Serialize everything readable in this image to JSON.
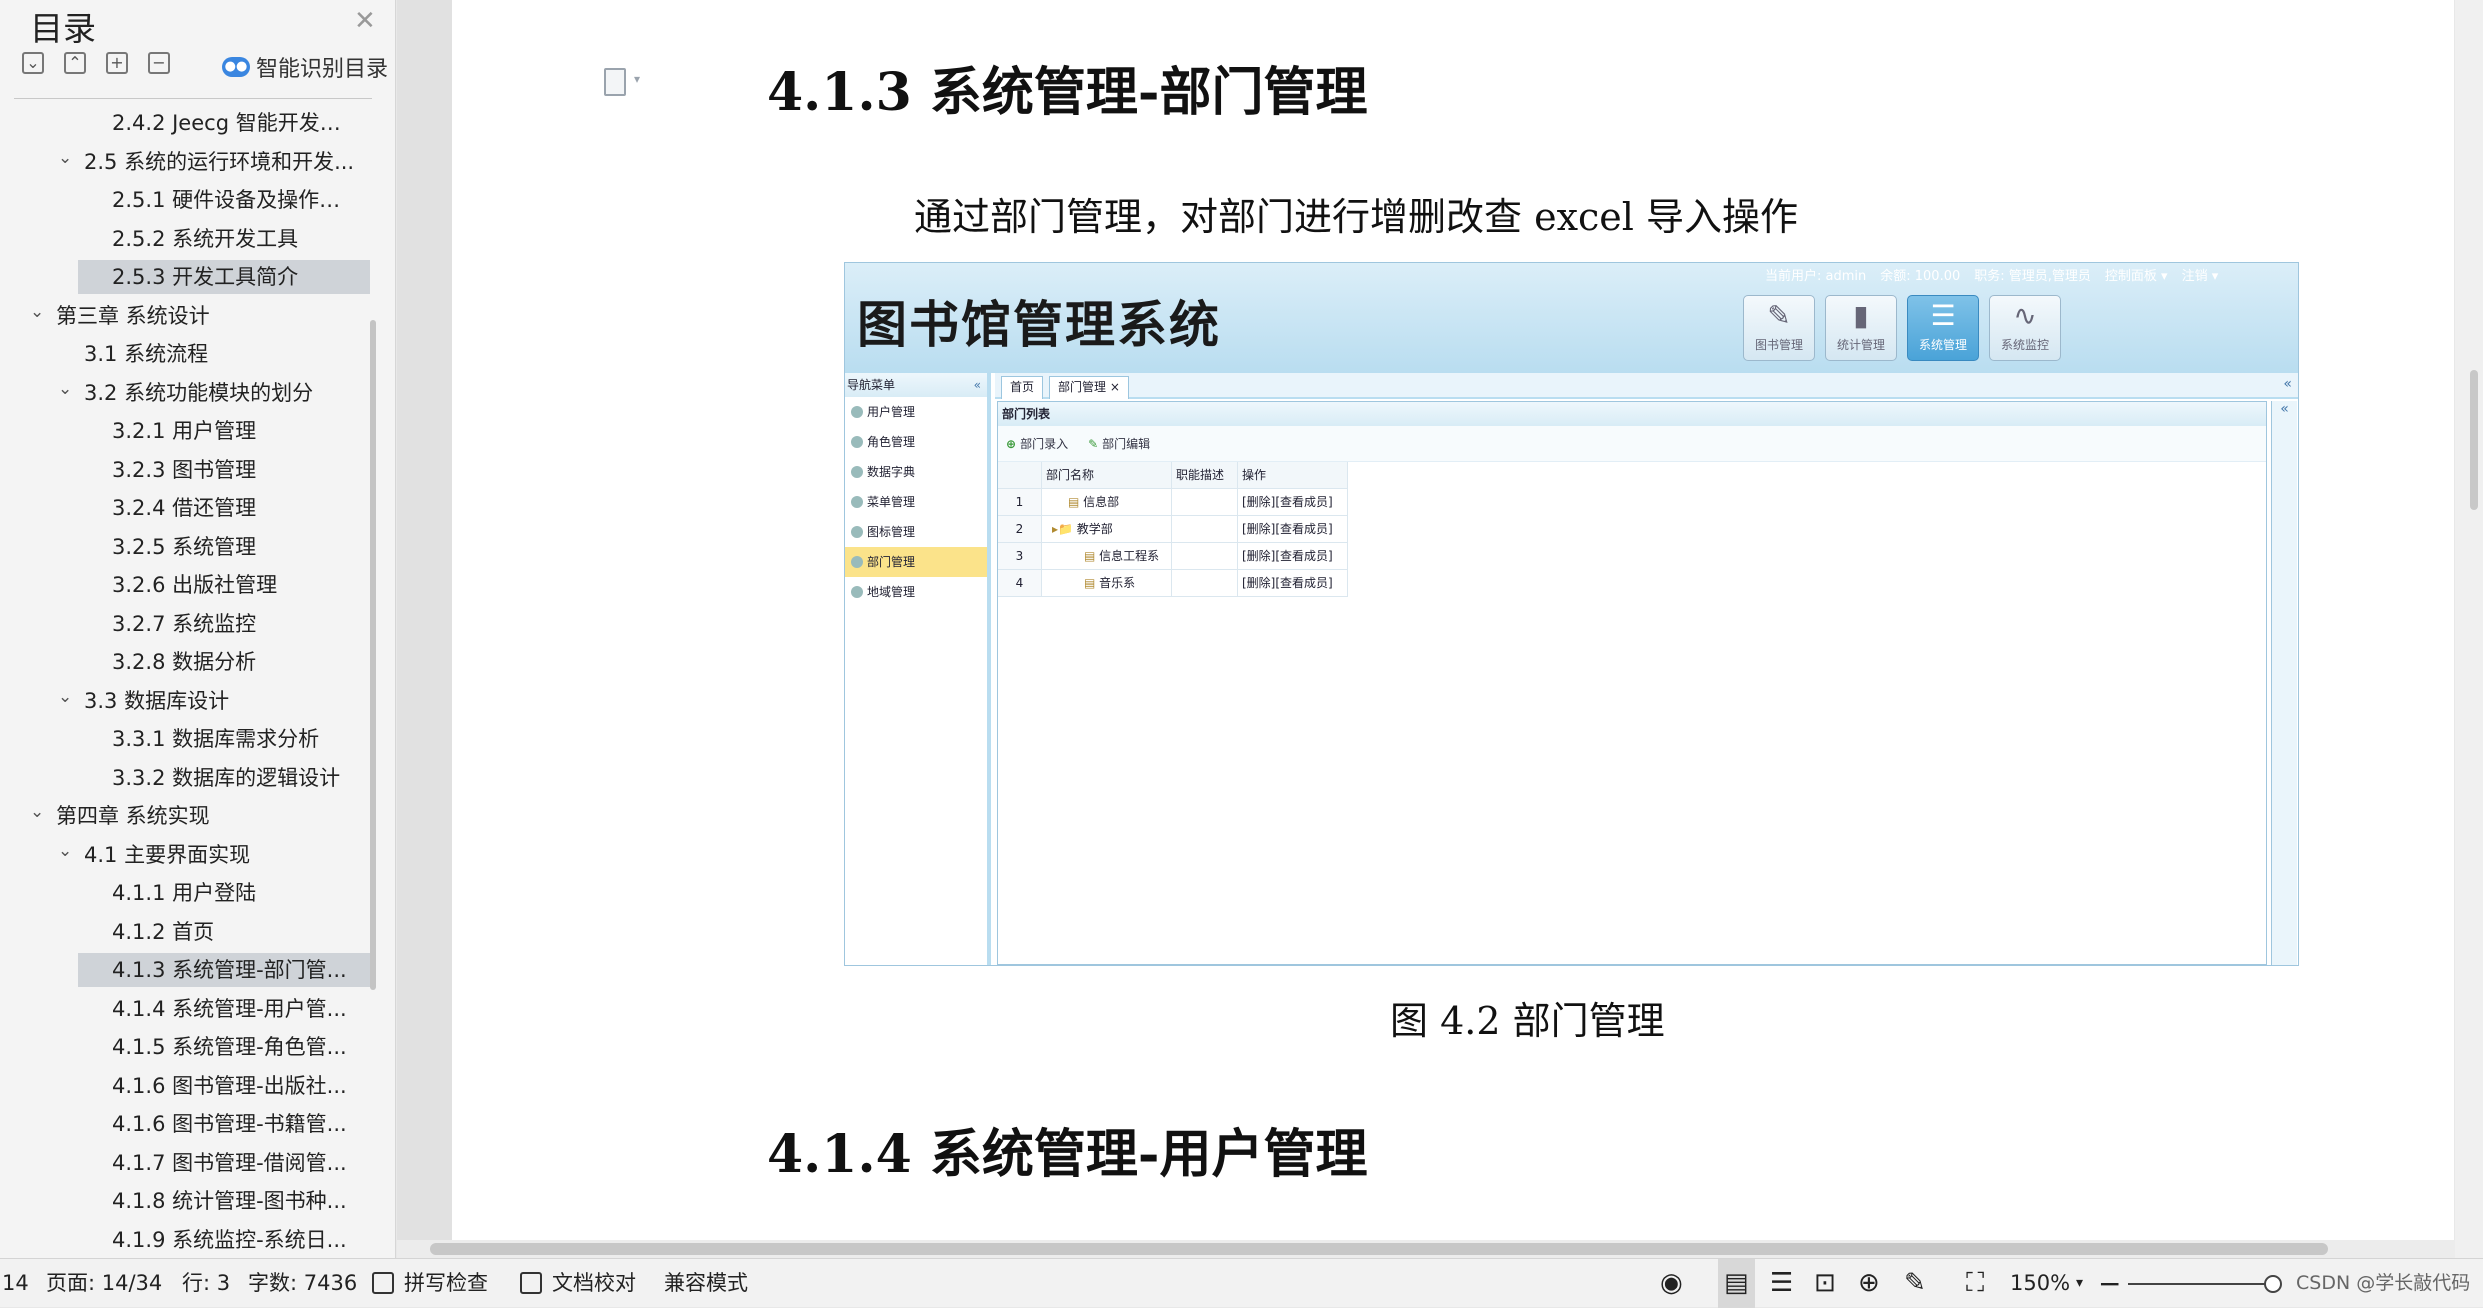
{
  "toc": {
    "title": "目录",
    "smart_label": "智能识别目录",
    "items": [
      {
        "label": "2.4.2 Jeecg 智能开发平...",
        "level": 3
      },
      {
        "label": "2.5 系统的运行环境和开发...",
        "level": 2,
        "expanded": true
      },
      {
        "label": "2.5.1 硬件设备及操作系...",
        "level": 3
      },
      {
        "label": "2.5.2 系统开发工具",
        "level": 3
      },
      {
        "label": "2.5.3 开发工具简介",
        "level": 3,
        "selected": true
      },
      {
        "label": "第三章 系统设计",
        "level": 1,
        "expanded": true
      },
      {
        "label": "3.1 系统流程",
        "level": 2
      },
      {
        "label": "3.2 系统功能模块的划分",
        "level": 2,
        "expanded": true
      },
      {
        "label": "3.2.1 用户管理",
        "level": 3
      },
      {
        "label": "3.2.3 图书管理",
        "level": 3
      },
      {
        "label": "3.2.4 借还管理",
        "level": 3
      },
      {
        "label": "3.2.5 系统管理",
        "level": 3
      },
      {
        "label": "3.2.6 出版社管理",
        "level": 3
      },
      {
        "label": "3.2.7 系统监控",
        "level": 3
      },
      {
        "label": "3.2.8 数据分析",
        "level": 3
      },
      {
        "label": "3.3 数据库设计",
        "level": 2,
        "expanded": true
      },
      {
        "label": "3.3.1 数据库需求分析",
        "level": 3
      },
      {
        "label": "3.3.2 数据库的逻辑设计",
        "level": 3
      },
      {
        "label": "第四章 系统实现",
        "level": 1,
        "expanded": true
      },
      {
        "label": "4.1 主要界面实现",
        "level": 2,
        "expanded": true
      },
      {
        "label": "4.1.1 用户登陆",
        "level": 3
      },
      {
        "label": "4.1.2 首页",
        "level": 3
      },
      {
        "label": "4.1.3 系统管理-部门管...",
        "level": 3,
        "selected": true
      },
      {
        "label": "4.1.4 系统管理-用户管...",
        "level": 3
      },
      {
        "label": "4.1.5 系统管理-角色管...",
        "level": 3
      },
      {
        "label": "4.1.6 图书管理-出版社...",
        "level": 3
      },
      {
        "label": "4.1.6 图书管理-书籍管...",
        "level": 3
      },
      {
        "label": "4.1.7 图书管理-借阅管...",
        "level": 3
      },
      {
        "label": "4.1.8 统计管理-图书种...",
        "level": 3
      },
      {
        "label": "4.1.9 系统监控-系统日...",
        "level": 3
      }
    ]
  },
  "doc": {
    "heading1": "4.1.3  系统管理-部门管理",
    "paragraph": "通过部门管理，对部门进行增删改查 excel 导入操作",
    "caption": "图 4.2 部门管理",
    "heading2": "4.1.4 系统管理-用户管理"
  },
  "shot": {
    "logo": "图书馆管理系统",
    "userbar": [
      "当前用户: admin",
      "余额: 100.00",
      "职务: 管理员,管理员",
      "控制面板 ▾",
      "注销 ▾"
    ],
    "toolbar_buttons": [
      {
        "label": "图书管理",
        "glyph": "✎",
        "active": false
      },
      {
        "label": "统计管理",
        "glyph": "▮",
        "active": false
      },
      {
        "label": "系统管理",
        "glyph": "☰",
        "active": true
      },
      {
        "label": "系统监控",
        "glyph": "∿",
        "active": false
      }
    ],
    "nav_title": "导航菜单",
    "nav_items": [
      {
        "label": "用户管理",
        "selected": false
      },
      {
        "label": "角色管理",
        "selected": false
      },
      {
        "label": "数据字典",
        "selected": false
      },
      {
        "label": "菜单管理",
        "selected": false
      },
      {
        "label": "图标管理",
        "selected": false
      },
      {
        "label": "部门管理",
        "selected": true
      },
      {
        "label": "地域管理",
        "selected": false
      }
    ],
    "tabs": [
      "首页",
      "部门管理 ×"
    ],
    "panel_title": "部门列表",
    "actions": [
      "部门录入",
      "部门编辑"
    ],
    "grid": {
      "columns": [
        "",
        "部门名称",
        "职能描述",
        "操作"
      ],
      "rows": [
        {
          "no": "1",
          "name": "信息部",
          "desc": "",
          "ops": "[删除][查看成员]",
          "indent": 1,
          "folder": false
        },
        {
          "no": "2",
          "name": "教学部",
          "desc": "",
          "ops": "[删除][查看成员]",
          "indent": 0,
          "folder": true
        },
        {
          "no": "3",
          "name": "信息工程系",
          "desc": "",
          "ops": "[删除][查看成员]",
          "indent": 2,
          "folder": false
        },
        {
          "no": "4",
          "name": "音乐系",
          "desc": "",
          "ops": "[删除][查看成员]",
          "indent": 2,
          "folder": false
        }
      ]
    }
  },
  "status": {
    "page_num_left": "14",
    "page": "页面: 14/34",
    "line": "行: 3",
    "words": "字数: 7436",
    "spell": "拼写检查",
    "proof": "文档校对",
    "compat": "兼容模式",
    "zoom": "150%",
    "watermark": "CSDN @学长敲代码"
  },
  "colors": {
    "accent": "#3a86e0",
    "selection": "#cfd3d8",
    "nav_selected": "#fbe38a"
  }
}
